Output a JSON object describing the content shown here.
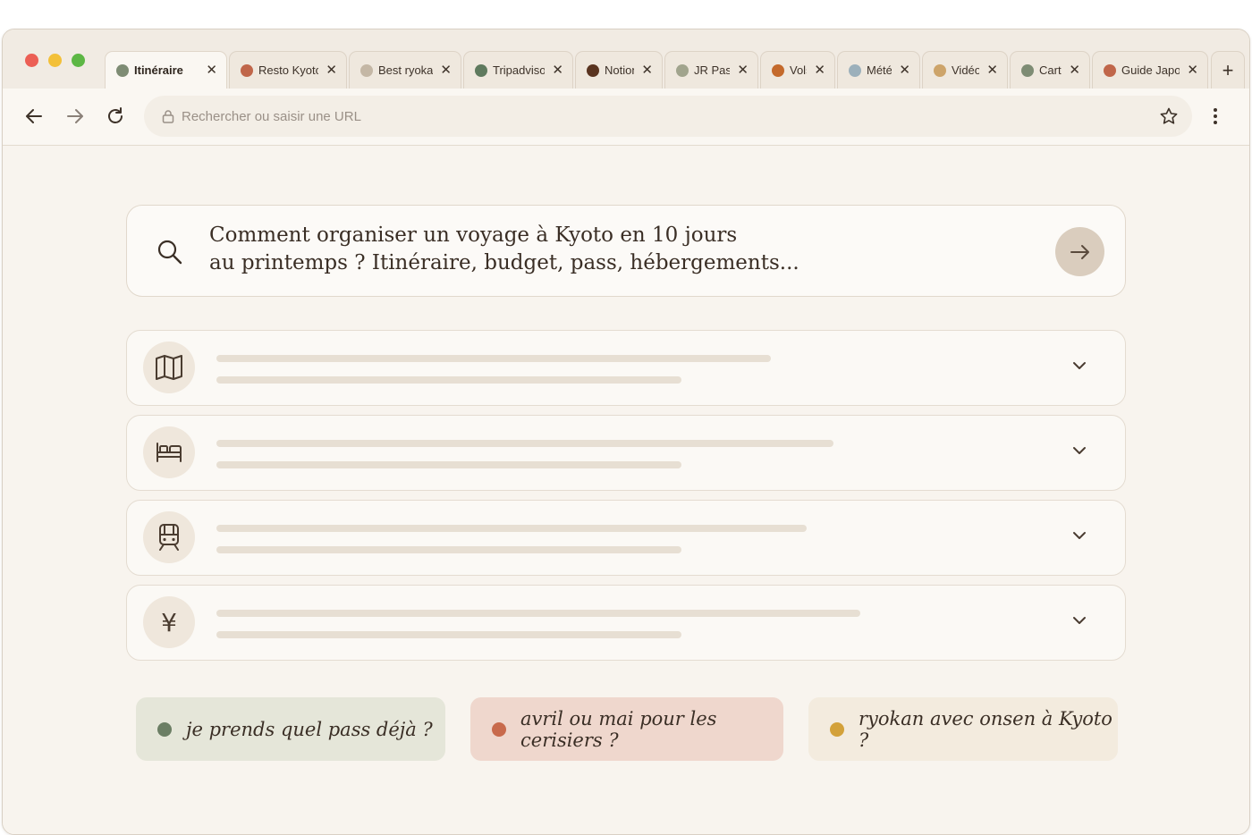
{
  "browser": {
    "tabs": [
      {
        "label": "Itinéraire",
        "color": "#7e8c74",
        "active": true
      },
      {
        "label": "Resto Kyoto",
        "color": "#c0664a",
        "active": false
      },
      {
        "label": "Best ryokan",
        "color": "#c4b7a5",
        "active": false
      },
      {
        "label": "Tripadvisor",
        "color": "#5f7a5e",
        "active": false
      },
      {
        "label": "Notion",
        "color": "#5a3420",
        "active": false
      },
      {
        "label": "JR Pass",
        "color": "#a1a48d",
        "active": false
      },
      {
        "label": "Vols",
        "color": "#c46a2c",
        "active": false
      },
      {
        "label": "Météo",
        "color": "#9cb0bb",
        "active": false
      },
      {
        "label": "Vidéos",
        "color": "#cda46a",
        "active": false
      },
      {
        "label": "Carte",
        "color": "#7e8c74",
        "active": false
      },
      {
        "label": "Guide Japon",
        "color": "#c0664a",
        "active": false
      }
    ],
    "close_glyph": "✕",
    "new_tab_glyph": "+",
    "url_placeholder": "Rechercher ou saisir une URL"
  },
  "query": {
    "line1": "Comment organiser un voyage à Kyoto en 10 jours",
    "line2": "au printemps ? Itinéraire, budget, pass, hébergements..."
  },
  "sections": [
    {
      "icon": "map-icon",
      "skeleton_fill": [
        0.62,
        0.52
      ]
    },
    {
      "icon": "bed-icon",
      "skeleton_fill": [
        0.69,
        0.52
      ]
    },
    {
      "icon": "train-icon",
      "skeleton_fill": [
        0.66,
        0.52
      ]
    },
    {
      "icon": "yen-icon",
      "skeleton_fill": [
        0.72,
        0.52
      ],
      "glyph": "¥"
    }
  ],
  "suggestions": [
    {
      "text": "je prends quel pass déjà ?",
      "bg": "#e5e6d9",
      "dot": "#6b7e64"
    },
    {
      "text": "avril ou mai pour les cerisiers ?",
      "bg": "#efd7cd",
      "dot": "#c86a4c"
    },
    {
      "text": "ryokan avec onsen à Kyoto ?",
      "bg": "#f3ebde",
      "dot": "#d3a13a"
    }
  ],
  "colors": {
    "background": "#f8f4ee",
    "accent": "#dacdbe",
    "text": "#3a2e25"
  }
}
